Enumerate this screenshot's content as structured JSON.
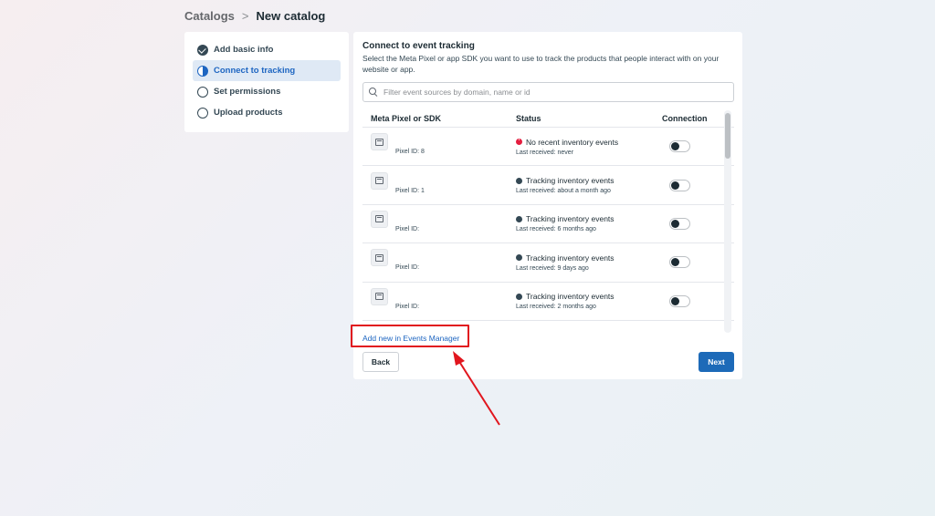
{
  "breadcrumb": {
    "parent": "Catalogs",
    "separator": ">",
    "current": "New catalog"
  },
  "steps": [
    {
      "label": "Add basic info",
      "state": "done"
    },
    {
      "label": "Connect to tracking",
      "state": "active"
    },
    {
      "label": "Set permissions",
      "state": "pending"
    },
    {
      "label": "Upload products",
      "state": "pending"
    }
  ],
  "panel": {
    "title": "Connect to event tracking",
    "description": "Select the Meta Pixel or app SDK you want to use to track the products that people interact with on your website or app.",
    "search_placeholder": "Filter event sources by domain, name or id"
  },
  "table": {
    "headers": {
      "pixel": "Meta Pixel or SDK",
      "status": "Status",
      "connection": "Connection"
    },
    "rows": [
      {
        "pixel_id": "Pixel ID: 8",
        "status": "No recent inventory events",
        "status_type": "warning",
        "last_received": "Last received: never"
      },
      {
        "pixel_id": "Pixel ID: 1",
        "status": "Tracking inventory events",
        "status_type": "ok",
        "last_received": "Last received: about a month ago"
      },
      {
        "pixel_id": "Pixel ID:",
        "status": "Tracking inventory events",
        "status_type": "ok",
        "last_received": "Last received: 6 months ago"
      },
      {
        "pixel_id": "Pixel ID:",
        "status": "Tracking inventory events",
        "status_type": "ok",
        "last_received": "Last received: 9 days ago"
      },
      {
        "pixel_id": "Pixel ID:",
        "status": "Tracking inventory events",
        "status_type": "ok",
        "last_received": "Last received: 2 months ago"
      }
    ]
  },
  "add_link": "Add new in Events Manager",
  "buttons": {
    "back": "Back",
    "next": "Next"
  },
  "colors": {
    "accent": "#1d6ab8",
    "annotation": "#e1161e",
    "warning": "#e41e3f"
  },
  "icons": [
    "check-circle-icon",
    "half-circle-icon",
    "empty-circle-icon",
    "search-icon",
    "pixel-code-icon",
    "status-dot-icon",
    "toggle-switch"
  ]
}
